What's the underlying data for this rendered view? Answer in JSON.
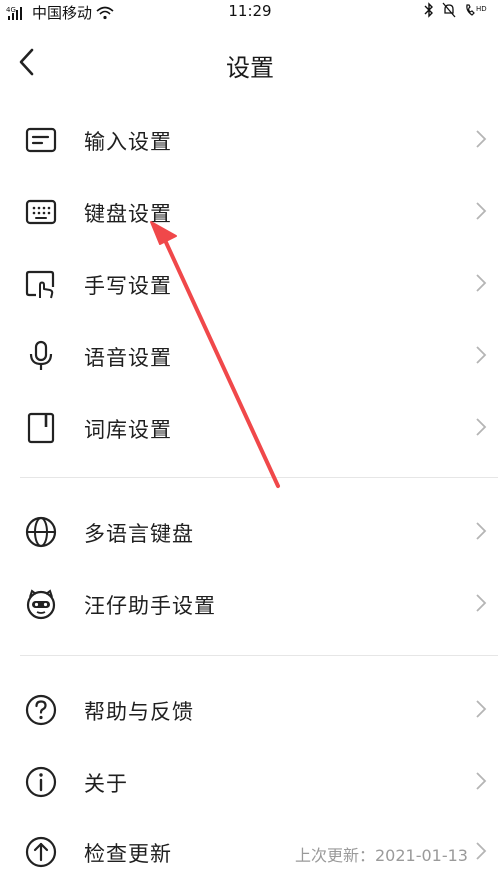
{
  "status": {
    "network": "4G",
    "carrier": "中国移动",
    "time": "11:29",
    "hd": "HD"
  },
  "header": {
    "title": "设置"
  },
  "settings": [
    {
      "label": "输入设置",
      "icon": "input-box-icon"
    },
    {
      "label": "键盘设置",
      "icon": "keyboard-icon"
    },
    {
      "label": "手写设置",
      "icon": "handwriting-icon"
    },
    {
      "label": "语音设置",
      "icon": "microphone-icon"
    },
    {
      "label": "词库设置",
      "icon": "dictionary-icon"
    },
    {
      "label": "多语言键盘",
      "icon": "globe-icon"
    },
    {
      "label": "汪仔助手设置",
      "icon": "assistant-mascot-icon"
    },
    {
      "label": "帮助与反馈",
      "icon": "help-icon"
    },
    {
      "label": "关于",
      "icon": "info-icon"
    },
    {
      "label": "检查更新",
      "icon": "update-icon",
      "value": "上次更新：2021-01-13"
    }
  ],
  "colors": {
    "annotation_arrow": "#f0484a"
  }
}
